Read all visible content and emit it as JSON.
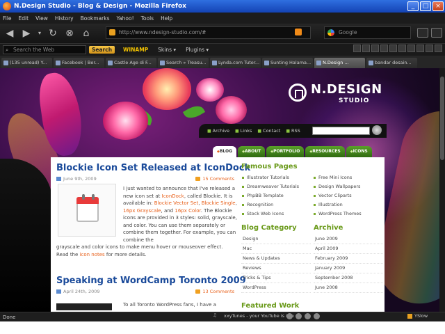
{
  "window": {
    "title": "N.Design Studio - Blog & Design - Mozilla Firefox"
  },
  "menu": [
    "File",
    "Edit",
    "View",
    "History",
    "Bookmarks",
    "Yahoo!",
    "Tools",
    "Help"
  ],
  "address": {
    "url": "http://www.ndesign-studio.com/#"
  },
  "search": {
    "placeholder": "Google"
  },
  "toolbar": {
    "web_search_placeholder": "Search the Web",
    "search_button": "Search",
    "winamp": "WINAMP",
    "skins": "Skins ▾",
    "plugins": "Plugins ▾"
  },
  "tabs": [
    "(135 unread) Y...",
    "Facebook | Ber...",
    "Castle Age di F...",
    "Search » Treasu...",
    "Lynda.com Tutor...",
    "Sunting Halama...",
    "N.Design ...",
    "bandar desain..."
  ],
  "site": {
    "logo_name": "N.DESIGN",
    "logo_sub": "STUDIO",
    "toplinks": [
      "Archive",
      "Links",
      "Contact",
      "RSS"
    ],
    "nav": [
      "BLOG",
      "ABOUT",
      "PORTFOLIO",
      "RESOURCES",
      "ICONS"
    ]
  },
  "post1": {
    "title": "Blockie Icon Set Released at IconDock",
    "date": "June 9th, 2009",
    "comments": "15 Comments",
    "t1": "I just wanted to announce that I've released a new icon set at ",
    "l1": "IconDock",
    "t2": ", called Blockie. It is available in: ",
    "l2": "Blockie Vector Set",
    "t3": ", ",
    "l3": "Blockie Single",
    "t4": ", ",
    "l4": "16px Grayscale",
    "t5": ", and ",
    "l5": "16px Color",
    "t6": ". The Blockie icons are provided in 3 styles: solid, grayscale, and color. You can use them separately or combine them together. For example, you can combine the",
    "t7": "grayscale and color icons to make menu hover or mouseover effect. Read the ",
    "l6": "icon notes",
    "t8": " for more details."
  },
  "post2": {
    "title": "Speaking at WordCamp Toronto 2009",
    "date": "April 24th, 2009",
    "comments": "13 Comments",
    "snippet": "To all Toronto WordPress fans, I have a"
  },
  "sidebar": {
    "famous_heading": "Famous Pages",
    "famous_left": [
      "Illustrator Tutorials",
      "Dreamweaver Tutorials",
      "PhpBB Template",
      "Recognition",
      "Stock Web Icons"
    ],
    "famous_right": [
      "Free Mini Icons",
      "Design Wallpapers",
      "Vector Cliparts",
      "Illustration",
      "WordPress Themes"
    ],
    "category_heading": "Blog Category",
    "categories": [
      "Design",
      "Mac",
      "News & Updates",
      "Reviews",
      "Tricks & Tips",
      "WordPress"
    ],
    "archive_heading": "Archive",
    "archives": [
      "June 2009",
      "April 2009",
      "February 2009",
      "January 2009",
      "September 2008",
      "June 2008"
    ],
    "featured_heading": "Featured Work"
  },
  "status": {
    "text": "Done",
    "now_playing": "xxyTunes - your YouTube is idle -",
    "yslow": "YSlow"
  }
}
